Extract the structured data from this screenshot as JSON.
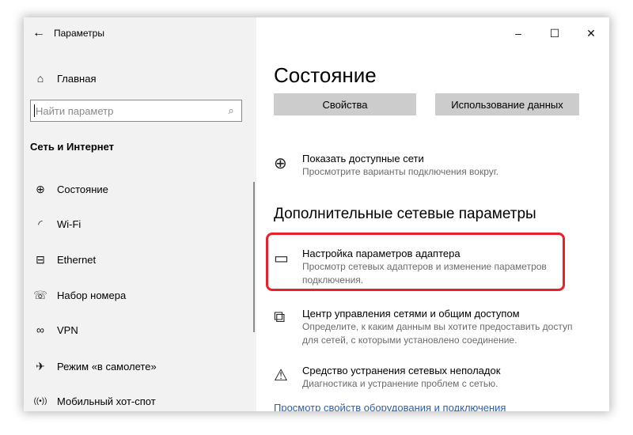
{
  "window": {
    "title": "Параметры",
    "back_icon": "←",
    "controls": {
      "minimize": "–",
      "maximize": "☐",
      "close": "✕"
    }
  },
  "sidebar": {
    "home": {
      "icon": "⌂",
      "label": "Главная"
    },
    "search": {
      "placeholder": "Найти параметр",
      "icon": "⌕"
    },
    "section_title": "Сеть и Интернет",
    "items": [
      {
        "icon": "⊕",
        "label": "Состояние"
      },
      {
        "icon": "◜",
        "label": "Wi-Fi"
      },
      {
        "icon": "⊟",
        "label": "Ethernet"
      },
      {
        "icon": "☏",
        "label": "Набор номера"
      },
      {
        "icon": "∞",
        "label": "VPN"
      },
      {
        "icon": "✈",
        "label": "Режим «в самолете»"
      },
      {
        "icon": "((•))",
        "label": "Мобильный хот-спот"
      }
    ]
  },
  "main": {
    "title": "Состояние",
    "buttons": {
      "properties": "Свойства",
      "data_usage": "Использование данных"
    },
    "show_networks": {
      "icon": "⊕",
      "title": "Показать доступные сети",
      "desc": "Просмотрите варианты подключения вокруг."
    },
    "advanced_header": "Дополнительные сетевые параметры",
    "adapter": {
      "icon": "▭",
      "title": "Настройка параметров адаптера",
      "desc1": "Просмотр сетевых адаптеров и изменение параметров",
      "desc2": "подключения."
    },
    "sharing": {
      "icon": "⧉",
      "title": "Центр управления сетями и общим доступом",
      "desc1": "Определите, к каким данным вы хотите предоставить доступ",
      "desc2": "для сетей, с которыми установлено соединение."
    },
    "troubleshoot": {
      "icon": "⚠",
      "title": "Средство устранения сетевых неполадок",
      "desc": "Диагностика и устранение проблем с сетью."
    },
    "hardware_link": "Просмотр свойств оборудования и подключения"
  },
  "colors": {
    "highlight": "#e8202a",
    "button_bg": "#cccccc",
    "sidebar_bg": "#f2f2f2",
    "link": "#2a5fb0"
  }
}
